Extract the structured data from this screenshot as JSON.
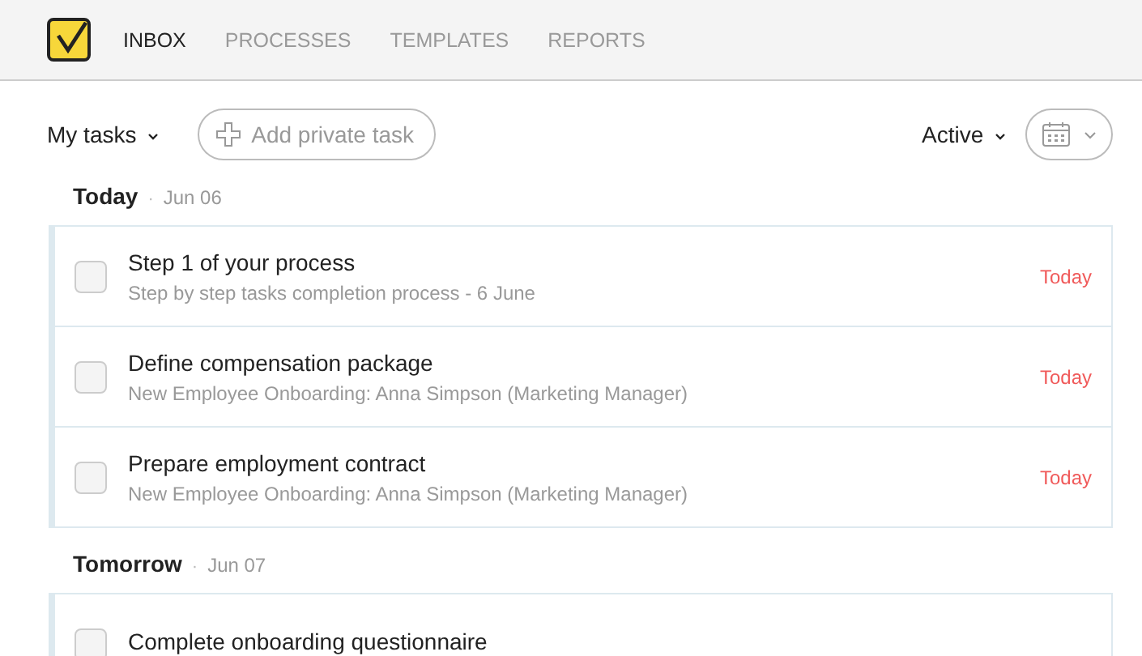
{
  "nav": {
    "tabs": [
      {
        "label": "INBOX",
        "selected": true
      },
      {
        "label": "PROCESSES",
        "selected": false
      },
      {
        "label": "TEMPLATES",
        "selected": false
      },
      {
        "label": "REPORTS",
        "selected": false
      }
    ]
  },
  "toolbar": {
    "filter": "My tasks",
    "add_button": "Add private task",
    "status_filter": "Active"
  },
  "groups": [
    {
      "title": "Today",
      "separator": "·",
      "date": "Jun 06",
      "tasks": [
        {
          "title": "Step 1 of your process",
          "subtitle": "Step by step tasks completion process - 6 June",
          "due": "Today",
          "checked": false
        },
        {
          "title": "Define compensation package",
          "subtitle": "New Employee Onboarding: Anna Simpson (Marketing Manager)",
          "due": "Today",
          "checked": false
        },
        {
          "title": "Prepare employment contract",
          "subtitle": "New Employee Onboarding: Anna Simpson (Marketing Manager)",
          "due": "Today",
          "checked": false
        }
      ]
    },
    {
      "title": "Tomorrow",
      "separator": "·",
      "date": "Jun 07",
      "tasks": [
        {
          "title": "Complete onboarding questionnaire",
          "checked": false
        }
      ]
    }
  ]
}
